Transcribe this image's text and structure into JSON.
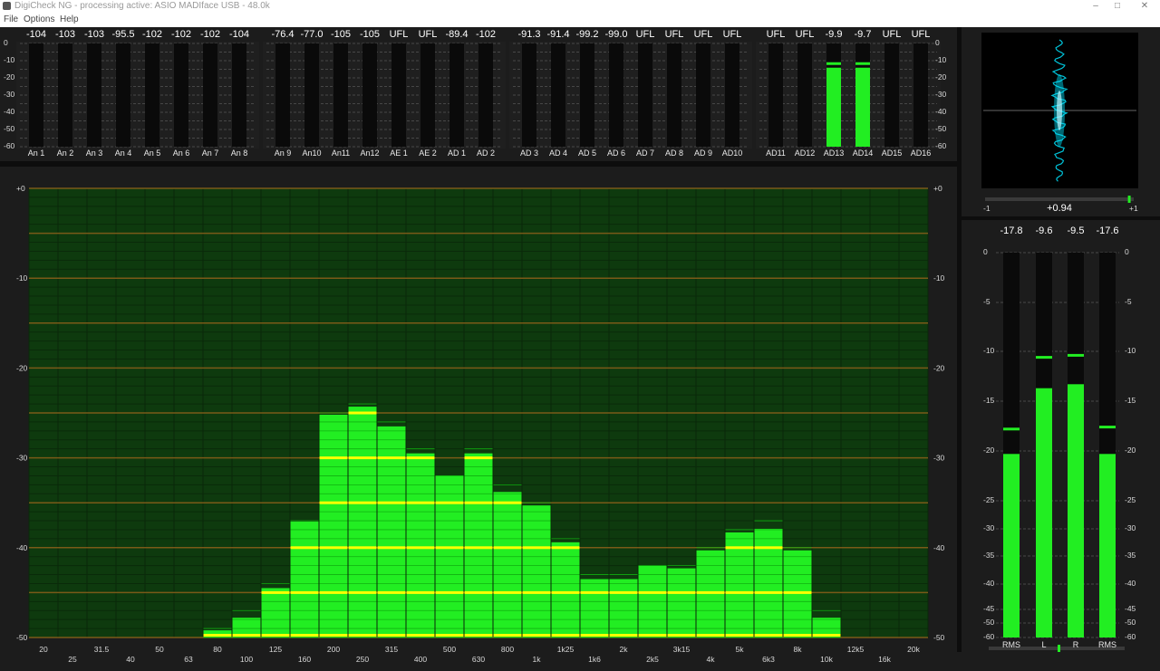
{
  "window": {
    "title": "DigiCheck NG - processing active: ASIO MADIface USB - 48.0k",
    "menu": [
      "File",
      "Options",
      "Help"
    ]
  },
  "colors": {
    "meter_green": "#22ee22",
    "peak_hold": "#ffff00",
    "background": "#1c1c1c",
    "rta_bg": "#0e3a0e",
    "gridline": "#7a5a18",
    "goniometer": "#00e5ff"
  },
  "channel_meters": {
    "scale": [
      "0",
      "-10",
      "-20",
      "-30",
      "-40",
      "-50",
      "-60"
    ],
    "groups": [
      {
        "channels": [
          {
            "label": "An 1",
            "readout": "-104",
            "level_db": -104
          },
          {
            "label": "An 2",
            "readout": "-103",
            "level_db": -103
          },
          {
            "label": "An 3",
            "readout": "-103",
            "level_db": -103
          },
          {
            "label": "An 4",
            "readout": "-95.5",
            "level_db": -95.5
          },
          {
            "label": "An 5",
            "readout": "-102",
            "level_db": -102
          },
          {
            "label": "An 6",
            "readout": "-102",
            "level_db": -102
          },
          {
            "label": "An 7",
            "readout": "-102",
            "level_db": -102
          },
          {
            "label": "An 8",
            "readout": "-104",
            "level_db": -104
          }
        ]
      },
      {
        "channels": [
          {
            "label": "An 9",
            "readout": "-76.4",
            "level_db": -76.4
          },
          {
            "label": "An10",
            "readout": "-77.0",
            "level_db": -77.0
          },
          {
            "label": "An11",
            "readout": "-105",
            "level_db": -105
          },
          {
            "label": "An12",
            "readout": "-105",
            "level_db": -105
          },
          {
            "label": "AE 1",
            "readout": "UFL",
            "level_db": null
          },
          {
            "label": "AE 2",
            "readout": "UFL",
            "level_db": null
          },
          {
            "label": "AD 1",
            "readout": "-89.4",
            "level_db": -89.4
          },
          {
            "label": "AD 2",
            "readout": "-102",
            "level_db": -102
          }
        ]
      },
      {
        "channels": [
          {
            "label": "AD 3",
            "readout": "-91.3",
            "level_db": -91.3
          },
          {
            "label": "AD 4",
            "readout": "-91.4",
            "level_db": -91.4
          },
          {
            "label": "AD 5",
            "readout": "-99.2",
            "level_db": -99.2
          },
          {
            "label": "AD 6",
            "readout": "-99.0",
            "level_db": -99.0
          },
          {
            "label": "AD 7",
            "readout": "UFL",
            "level_db": null
          },
          {
            "label": "AD 8",
            "readout": "UFL",
            "level_db": null
          },
          {
            "label": "AD 9",
            "readout": "UFL",
            "level_db": null
          },
          {
            "label": "AD10",
            "readout": "UFL",
            "level_db": null
          }
        ]
      },
      {
        "channels": [
          {
            "label": "AD11",
            "readout": "UFL",
            "level_db": null
          },
          {
            "label": "AD12",
            "readout": "UFL",
            "level_db": null
          },
          {
            "label": "AD13",
            "readout": "-9.9",
            "level_db": -12.5
          },
          {
            "label": "AD14",
            "readout": "-9.7",
            "level_db": -12.5
          },
          {
            "label": "AD15",
            "readout": "UFL",
            "level_db": null
          },
          {
            "label": "AD16",
            "readout": "UFL",
            "level_db": null
          }
        ]
      }
    ]
  },
  "goniometer": {
    "correlation": "+0.94",
    "correlation_value": 0.94,
    "min_label": "-1",
    "max_label": "+1"
  },
  "level_meters": {
    "scale": [
      "0",
      "-5",
      "-10",
      "-15",
      "-20",
      "-25",
      "-30",
      "-35",
      "-40",
      "-45",
      "-50",
      "-60"
    ],
    "meters": [
      {
        "label": "RMS",
        "readout": "-17.8",
        "level_db": -20.3,
        "peak_db": -17.8
      },
      {
        "label": "L",
        "readout": "-9.6",
        "level_db": -13.7,
        "peak_db": -10.6
      },
      {
        "label": "R",
        "readout": "-9.5",
        "level_db": -13.3,
        "peak_db": -10.4
      },
      {
        "label": "RMS",
        "readout": "-17.6",
        "level_db": -20.3,
        "peak_db": -17.6
      }
    ]
  },
  "chart_data": {
    "type": "bar",
    "title": "",
    "xlabel": "",
    "ylabel": "",
    "ylim": [
      -50,
      0
    ],
    "y_ticks": [
      "+0",
      "-10",
      "-20",
      "-30",
      "-40",
      "-50"
    ],
    "categories": [
      "20",
      "25",
      "31.5",
      "40",
      "50",
      "63",
      "80",
      "100",
      "125",
      "160",
      "200",
      "250",
      "315",
      "400",
      "500",
      "630",
      "800",
      "1k",
      "1k25",
      "1k6",
      "2k",
      "2k5",
      "3k15",
      "4k",
      "5k",
      "6k3",
      "8k",
      "10k",
      "12k5",
      "16k",
      "20k"
    ],
    "values": [
      -52,
      -52,
      -52,
      -52,
      -52,
      -52,
      -49.2,
      -47.8,
      -44.5,
      -37.1,
      -25.2,
      -24.3,
      -26.5,
      -29.5,
      -32.0,
      -29.5,
      -33.8,
      -35.3,
      -39.4,
      -43.5,
      -43.5,
      -42.0,
      -42.3,
      -40.3,
      -38.3,
      -37.9,
      -40.3,
      -47.8,
      -52,
      -52,
      -52
    ]
  }
}
